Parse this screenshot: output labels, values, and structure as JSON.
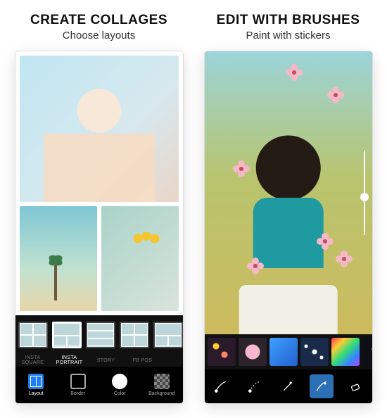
{
  "left": {
    "title": "CREATE COLLAGES",
    "subtitle": "Choose layouts",
    "formats": [
      {
        "id": "insta-square",
        "label": "INSTA SQUARE",
        "active": false
      },
      {
        "id": "insta-portrait",
        "label": "INSTA PORTRAIT",
        "active": true
      },
      {
        "id": "story",
        "label": "STORY",
        "active": false
      },
      {
        "id": "fb-post",
        "label": "FB POS",
        "active": false
      }
    ],
    "tools": [
      {
        "id": "layout",
        "label": "Layout",
        "icon": "layout-icon",
        "active": true
      },
      {
        "id": "border",
        "label": "Border",
        "icon": "border-icon",
        "active": false
      },
      {
        "id": "color",
        "label": "Color",
        "icon": "color-icon",
        "active": false
      },
      {
        "id": "background",
        "label": "Background",
        "icon": "background-icon",
        "active": false
      }
    ]
  },
  "right": {
    "title": "EDIT WITH BRUSHES",
    "subtitle": "Paint with stickers",
    "slider": {
      "value": 50
    },
    "sticker_packs": [
      {
        "id": "bokeh-stars"
      },
      {
        "id": "pink-flowers"
      },
      {
        "id": "blue-glow"
      },
      {
        "id": "sparkles"
      },
      {
        "id": "rainbow"
      },
      {
        "id": "night-stars"
      }
    ],
    "brushes": [
      {
        "id": "brush-simple",
        "icon": "brush-icon",
        "active": false
      },
      {
        "id": "brush-dotted",
        "icon": "brush-dotted-icon",
        "active": false
      },
      {
        "id": "brush-magic",
        "icon": "magic-wand-icon",
        "active": false
      },
      {
        "id": "brush-sticker",
        "icon": "sticker-brush-icon",
        "active": true
      },
      {
        "id": "eraser",
        "icon": "eraser-icon",
        "active": false
      }
    ],
    "flower_color": "#f6b8c4"
  }
}
